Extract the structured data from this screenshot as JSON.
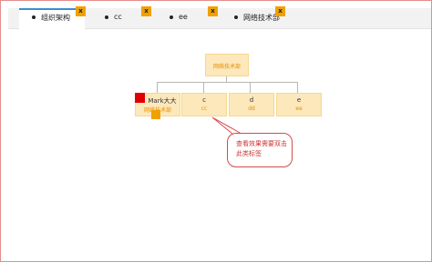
{
  "tabs": [
    {
      "label": "组织架构",
      "active": true,
      "close_label": "x"
    },
    {
      "label": "cc",
      "active": false,
      "close_label": "x"
    },
    {
      "label": "ee",
      "active": false,
      "close_label": "x"
    },
    {
      "label": "网络技术部",
      "active": false,
      "close_label": "x"
    }
  ],
  "org": {
    "root": {
      "name": "网络技术部"
    },
    "children": [
      {
        "name": "Mark大大",
        "sub": "网络技术部"
      },
      {
        "name": "c",
        "sub": "cc"
      },
      {
        "name": "d",
        "sub": "dd"
      },
      {
        "name": "e",
        "sub": "ee"
      }
    ]
  },
  "callout": {
    "text": "查看效果需要双击此类标签"
  },
  "colors": {
    "accent": "#3a8ed6",
    "node_bg": "#fde8bb",
    "orange": "#f0a000",
    "marker": "#e00000",
    "callout_border": "#d64a4a",
    "frame_border": "#e58c8c"
  },
  "icons": {
    "tab_close": "close-icon",
    "selection": "selection-marker",
    "drag": "drag-handle"
  }
}
